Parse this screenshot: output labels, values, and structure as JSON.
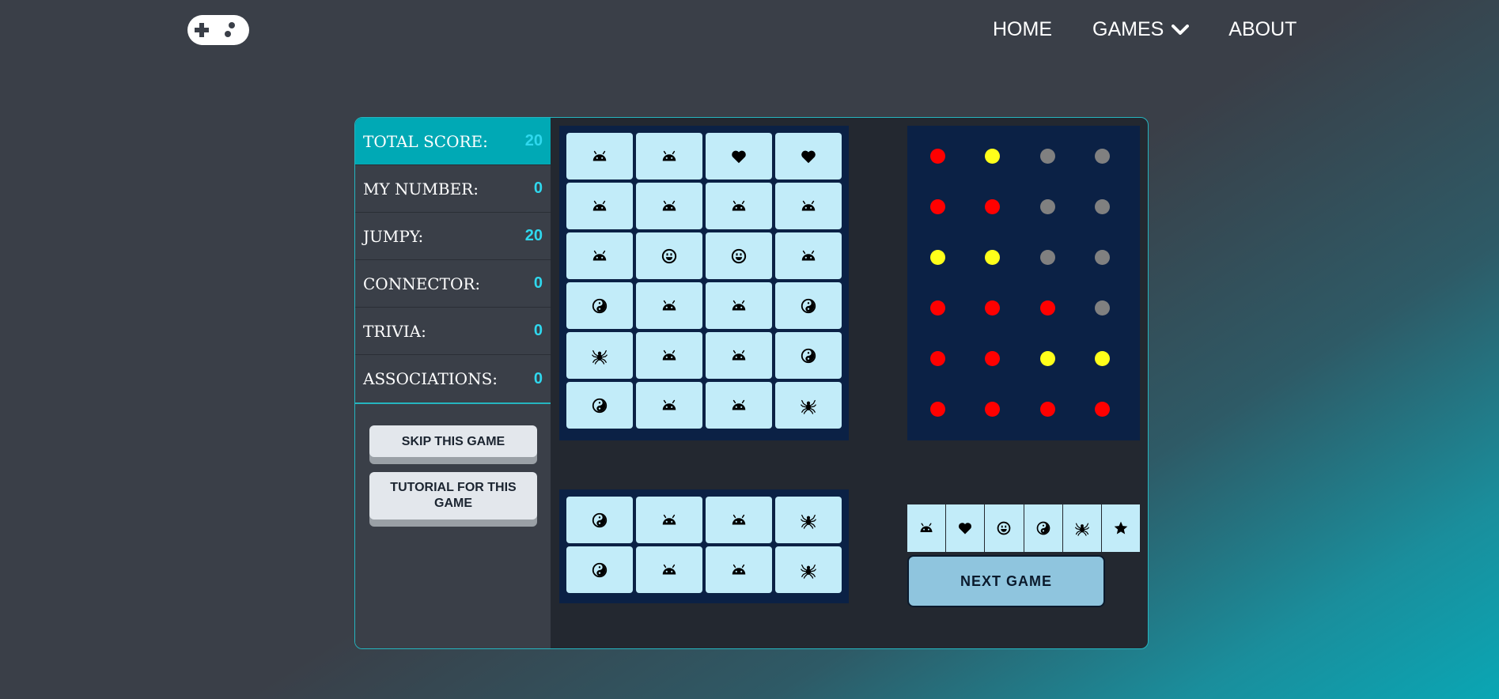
{
  "nav": {
    "logo_icon": "gamepad-icon",
    "home": "HOME",
    "games": "GAMES",
    "about": "ABOUT"
  },
  "scores": [
    {
      "label": "TOTAL SCORE:",
      "value": "20"
    },
    {
      "label": "MY NUMBER:",
      "value": "0"
    },
    {
      "label": "JUMPY:",
      "value": "20"
    },
    {
      "label": "CONNECTOR:",
      "value": "0"
    },
    {
      "label": "TRIVIA:",
      "value": "0"
    },
    {
      "label": "ASSOCIATIONS:",
      "value": "0"
    }
  ],
  "buttons": {
    "skip": "SKIP THIS GAME",
    "tutorial": "TUTORIAL FOR THIS GAME",
    "next": "NEXT GAME"
  },
  "main_board": [
    [
      "android",
      "android",
      "heart",
      "heart"
    ],
    [
      "android",
      "android",
      "android",
      "android"
    ],
    [
      "android",
      "smiley",
      "smiley",
      "android"
    ],
    [
      "yin-yang",
      "android",
      "android",
      "yin-yang"
    ],
    [
      "spider",
      "android",
      "android",
      "yin-yang"
    ],
    [
      "yin-yang",
      "android",
      "android",
      "spider"
    ]
  ],
  "small_board": [
    [
      "yin-yang",
      "android",
      "android",
      "spider"
    ],
    [
      "yin-yang",
      "android",
      "android",
      "spider"
    ]
  ],
  "dot_grid": [
    [
      "red",
      "yellow",
      "gray",
      "gray"
    ],
    [
      "red",
      "red",
      "gray",
      "gray"
    ],
    [
      "yellow",
      "yellow",
      "gray",
      "gray"
    ],
    [
      "red",
      "red",
      "red",
      "gray"
    ],
    [
      "red",
      "red",
      "yellow",
      "yellow"
    ],
    [
      "red",
      "red",
      "red",
      "red"
    ]
  ],
  "palette": [
    "android",
    "heart",
    "smiley",
    "yin-yang",
    "spider",
    "star"
  ],
  "colors": {
    "accent": "#00a9b5",
    "score_value": "#2fd8ee",
    "tile": "#c2ecf9",
    "board": "#0b2145",
    "red": "#ff0000",
    "yellow": "#ffff1a",
    "gray": "#808080",
    "next_button": "#8fc5de"
  }
}
